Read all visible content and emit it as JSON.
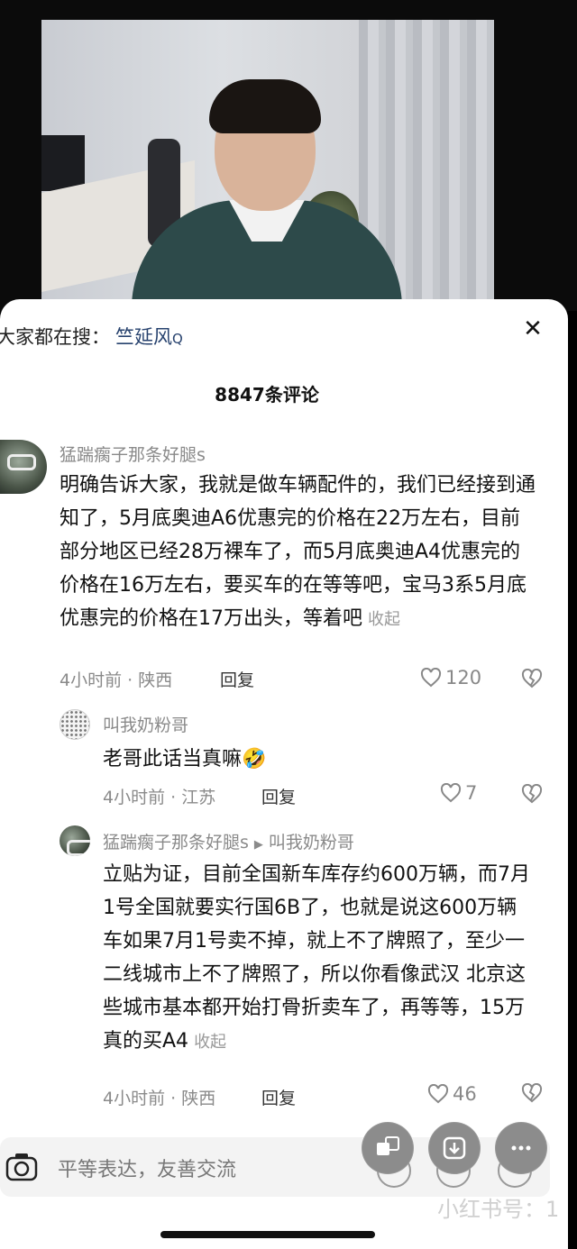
{
  "search": {
    "prefix": "大家都在搜：",
    "keyword": "竺延风",
    "search_glyph": "Q"
  },
  "close_glyph": "✕",
  "comments_count": "8847条评论",
  "comments": [
    {
      "user": "猛踹瘸子那条好腿s",
      "text": "明确告诉大家，我就是做车辆配件的，我们已经接到通知了，5月底奥迪A6优惠完的价格在22万左右，目前部分地区已经28万裸车了，而5月底奥迪A4优惠完的价格在16万左右，要买车的在等等吧，宝马3系5月底优惠完的价格在17万出头，等着吧",
      "fold": "收起",
      "meta": "4小时前 · 陕西",
      "reply": "回复",
      "likes": "120"
    },
    {
      "user": "叫我奶粉哥",
      "text": "老哥此话当真嘛🤣",
      "meta": "4小时前 · 江苏",
      "reply": "回复",
      "likes": "7"
    },
    {
      "user": "猛踹瘸子那条好腿s",
      "arrow": "▶",
      "reply_to": "叫我奶粉哥",
      "text": "立贴为证，目前全国新车库存约600万辆，而7月1号全国就要实行国6B了，也就是说这600万辆车如果7月1号卖不掉，就上不了牌照了，至少一二线城市上不了牌照了，所以你看像武汉 北京这些城市基本都开始打骨折卖车了，再等等，15万真的买A4",
      "fold": "收起",
      "meta": "4小时前 · 陕西",
      "reply": "回复",
      "likes": "46"
    }
  ],
  "input": {
    "placeholder": "平等表达，友善交流"
  },
  "watermark": "小红书号：1",
  "colors": {
    "accent_link": "#27426e",
    "muted": "#8a8a8a"
  }
}
